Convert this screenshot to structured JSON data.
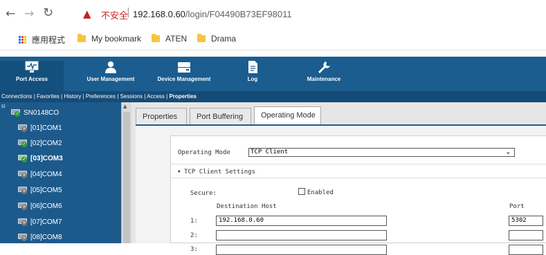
{
  "browser": {
    "insecure_label": "不安全",
    "url_host": "192.168.0.60",
    "url_path": "/login/F04490B73EF98011"
  },
  "bookmarks": {
    "apps": "應用程式",
    "items": [
      "My bookmark",
      "ATEN",
      "Drama"
    ]
  },
  "toolbar": {
    "items": [
      "Port Access",
      "User Management",
      "Device Management",
      "Log",
      "Maintenance"
    ]
  },
  "subnav": {
    "items": [
      "Connections",
      "Favorites",
      "History",
      "Preferences",
      "Sessions",
      "Access"
    ],
    "active": "Properties"
  },
  "sidebar": {
    "root": "SN0148CO",
    "ports": [
      "[01]COM1",
      "[02]COM2",
      "[03]COM3",
      "[04]COM4",
      "[05]COM5",
      "[06]COM6",
      "[07]COM7",
      "[08]COM8"
    ]
  },
  "tabs": [
    "Properties",
    "Port Buffering",
    "Operating Mode"
  ],
  "form": {
    "mode_label": "Operating Mode",
    "mode_value": "TCP Client",
    "section_title": "TCP Client Settings",
    "secure_label": "Secure:",
    "enabled_label": "Enabled",
    "dest_header": "Destination Host",
    "port_header": "Port",
    "rows": [
      {
        "num": "1:",
        "host": "192.168.0.60",
        "port": "5302"
      },
      {
        "num": "2:",
        "host": "",
        "port": ""
      },
      {
        "num": "3:",
        "host": "",
        "port": ""
      }
    ]
  }
}
